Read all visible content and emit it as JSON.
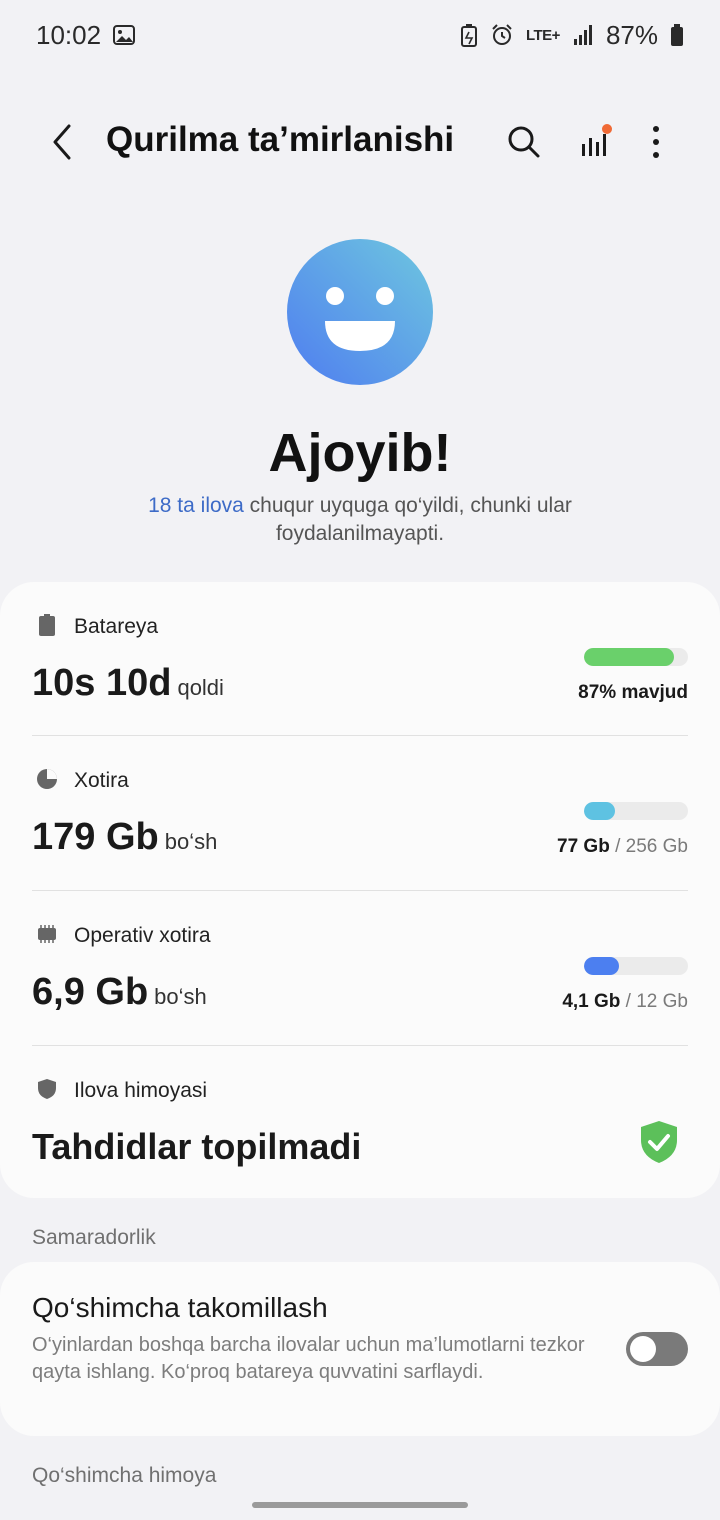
{
  "status_bar": {
    "time": "10:02",
    "lte_label": "LTE+",
    "battery_percent": "87%"
  },
  "header": {
    "title": "Qurilma ta’mirlanishi"
  },
  "hero": {
    "title": "Ajoyib!",
    "subtitle_link": "18 ta ilova",
    "subtitle_rest": " chuqur uyquga qo‘yildi, chunki ular foydalanilmayapti."
  },
  "battery": {
    "label": "Batareya",
    "value": "10s 10d",
    "unit": "qoldi",
    "caption": "87% mavjud",
    "fill_fraction": 0.87,
    "color": "#6ad06b"
  },
  "storage": {
    "label": "Xotira",
    "value": "179 Gb",
    "unit": "bo‘sh",
    "used": "77 Gb",
    "total": " / 256 Gb",
    "fill_fraction": 0.3,
    "color": "#5ec2e2"
  },
  "memory": {
    "label": "Operativ xotira",
    "value": "6,9 Gb",
    "unit": "bo‘sh",
    "used": "4,1 Gb",
    "total": " / 12 Gb",
    "fill_fraction": 0.34,
    "color": "#4c7ff0"
  },
  "app_protection": {
    "label": "Ilova himoyasi",
    "value": "Tahdidlar topilmadi"
  },
  "performance": {
    "section_title": "Samaradorlik",
    "item_title": "Qo‘shimcha takomillash",
    "item_description": "O‘yinlardan boshqa barcha ilovalar uchun ma’lumotlarni tezkor qayta ishlang. Ko‘proq batareya quvvatini sarflaydi.",
    "toggle_on": false
  },
  "extra_protection": {
    "section_title": "Qo‘shimcha himoya"
  },
  "colors": {
    "accent_link": "#3d6bc7",
    "shield": "#5cc05a",
    "face_gradient_start": "#6ec7df",
    "face_gradient_end": "#4f7df0"
  }
}
